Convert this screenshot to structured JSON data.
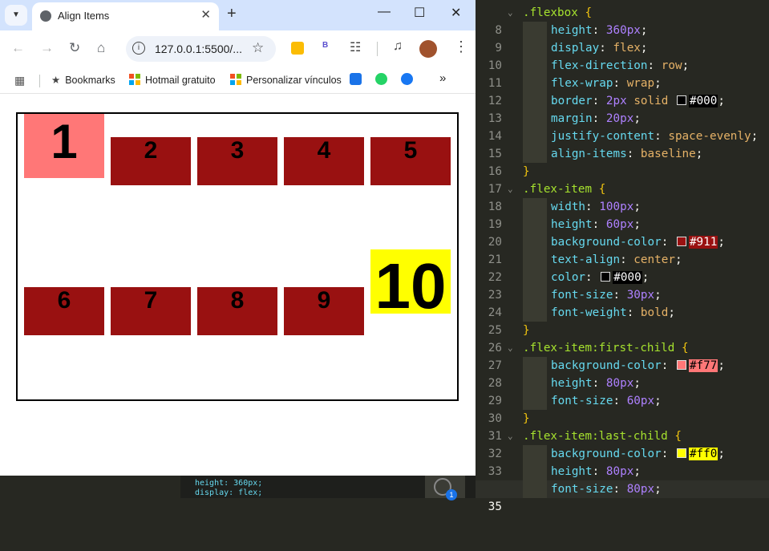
{
  "browser": {
    "tab_title": "Align Items",
    "url": "127.0.0.1:5500/...",
    "bookmarks": [
      {
        "label": "Bookmarks",
        "icon": "star-icon"
      },
      {
        "label": "Hotmail gratuito",
        "icon": "microsoft-logo"
      },
      {
        "label": "Personalizar vínculos",
        "icon": "microsoft-logo"
      }
    ]
  },
  "page": {
    "items": [
      "1",
      "2",
      "3",
      "4",
      "5",
      "6",
      "7",
      "8",
      "9",
      "10"
    ],
    "colors": {
      "item": "#991111",
      "first": "#ff7777",
      "last": "#ffff00",
      "border": "#000000"
    }
  },
  "editor": {
    "lines": [
      {
        "n": "8",
        "text": ".flexbox {"
      },
      {
        "n": "9",
        "text": "height: 360px;"
      },
      {
        "n": "10",
        "text": "display: flex;"
      },
      {
        "n": "11",
        "text": "flex-direction: row;"
      },
      {
        "n": "12",
        "text": "flex-wrap: wrap;"
      },
      {
        "n": "13",
        "text": "border: 2px solid #000;"
      },
      {
        "n": "14",
        "text": "margin: 20px;"
      },
      {
        "n": "15",
        "text": "justify-content: space-evenly;"
      },
      {
        "n": "16",
        "text": "align-items: baseline;"
      },
      {
        "n": "17",
        "text": "}"
      },
      {
        "n": "18",
        "text": ".flex-item {"
      },
      {
        "n": "19",
        "text": "width: 100px;"
      },
      {
        "n": "20",
        "text": "height: 60px;"
      },
      {
        "n": "21",
        "text": "background-color: #911;"
      },
      {
        "n": "22",
        "text": "text-align: center;"
      },
      {
        "n": "23",
        "text": "color: #000;"
      },
      {
        "n": "24",
        "text": "font-size: 30px;"
      },
      {
        "n": "25",
        "text": "font-weight: bold;"
      },
      {
        "n": "26",
        "text": "}"
      },
      {
        "n": "27",
        "text": ".flex-item:first-child {"
      },
      {
        "n": "28",
        "text": "background-color: #f77;"
      },
      {
        "n": "29",
        "text": "height: 80px;"
      },
      {
        "n": "30",
        "text": "font-size: 60px;"
      },
      {
        "n": "31",
        "text": "}"
      },
      {
        "n": "32",
        "text": ".flex-item:last-child {"
      },
      {
        "n": "33",
        "text": "background-color: #ff0;"
      },
      {
        "n": "34",
        "text": "height: 80px;"
      },
      {
        "n": "35",
        "text": "font-size: 80px;"
      }
    ],
    "active_line": "35"
  },
  "background_strip": {
    "line1": "height: 360px;",
    "line2": "display: flex;",
    "badge": "1"
  }
}
